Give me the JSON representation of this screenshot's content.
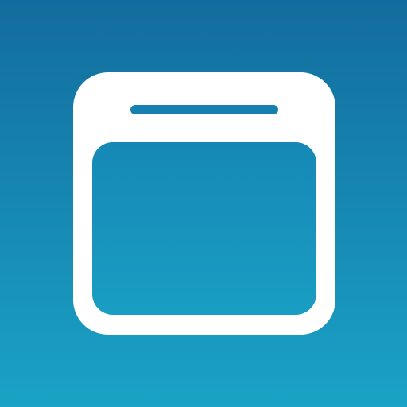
{
  "icon": {
    "name": "browser-window-icon",
    "background_colors": [
      "#136c9d",
      "#1aa3c6"
    ],
    "glyph_color": "#ffffff"
  }
}
